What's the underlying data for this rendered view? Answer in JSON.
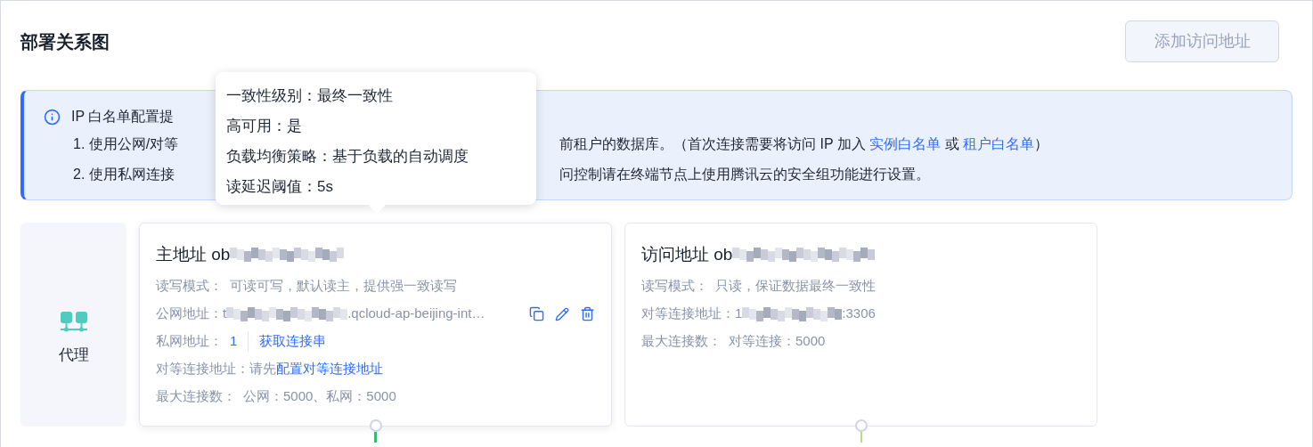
{
  "page": {
    "title": "部署关系图",
    "add_button": {
      "label": "添加访问地址",
      "disabled": true
    }
  },
  "alert": {
    "title": "IP 白名单配置提",
    "lines": [
      {
        "left": "1. 使用公网/对等",
        "right": [
          {
            "kind": "text",
            "text": "前租户的数据库。（首次连接需要将访问 IP 加入 "
          },
          {
            "kind": "link",
            "text": "实例白名单"
          },
          {
            "kind": "text",
            "text": " 或 "
          },
          {
            "kind": "link",
            "text": "租户白名单"
          },
          {
            "kind": "text",
            "text": "）"
          }
        ]
      },
      {
        "left": "2. 使用私网连接",
        "right": [
          {
            "kind": "text",
            "text": "问控制请在终端节点上使用腾讯云的安全组功能进行设置。"
          }
        ]
      }
    ]
  },
  "tooltip": {
    "lines": [
      "一致性级别：最终一致性",
      "高可用：是",
      "负载均衡策略：基于负载的自动调度",
      "读延迟阈值：5s"
    ]
  },
  "proxy": {
    "label": "代理"
  },
  "cards": [
    {
      "title": "主地址 ob",
      "kind": "primary",
      "rows": [
        {
          "kind": "text",
          "label": "读写模式：",
          "value": "可读可写，默认读主，提供强一致读写"
        },
        {
          "kind": "masked",
          "label": "公网地址：t",
          "suffix": ".qcloud-ap-beijing-int…",
          "actions": true
        },
        {
          "kind": "count_link",
          "label": "私网地址：",
          "count": "1",
          "link": "获取连接串"
        },
        {
          "kind": "link",
          "label": "对等连接地址：请先",
          "link": "配置对等连接地址"
        },
        {
          "kind": "text",
          "label": "最大连接数：",
          "value": "公网：5000、私网：5000"
        }
      ]
    },
    {
      "title": "访问地址 ob",
      "kind": "replica",
      "rows": [
        {
          "kind": "text",
          "label": "读写模式：",
          "value": "只读，保证数据最终一致性"
        },
        {
          "kind": "masked",
          "label": "对等连接地址：1",
          "suffix": ":3306",
          "actions": false
        },
        {
          "kind": "text",
          "label": "最大连接数：",
          "value": "对等连接：5000"
        }
      ]
    }
  ]
}
